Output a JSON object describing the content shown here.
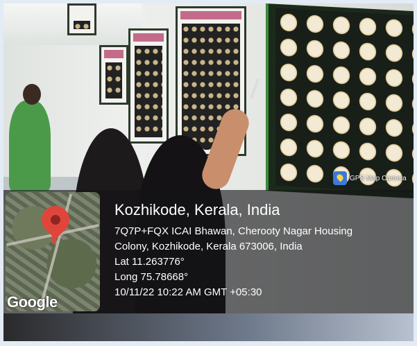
{
  "gps_camera": {
    "badge": "GPS Map Camera",
    "location_title": "Kozhikode, Kerala, India",
    "address_line1": "7Q7P+FQX ICAI Bhawan, Cherooty Nagar Housing",
    "address_line2": "Colony, Kozhikode, Kerala 673006, India",
    "lat": "Lat 11.263776°",
    "long": "Long 75.78668°",
    "datetime": "10/11/22 10:22 AM GMT +05:30"
  },
  "map": {
    "brand": "Google",
    "pin_icon": "map-pin-icon",
    "pin_color": "#e0453c"
  },
  "colors": {
    "overlay": "rgba(20,20,22,0.62)",
    "board_frame": "#3a8a3a"
  }
}
